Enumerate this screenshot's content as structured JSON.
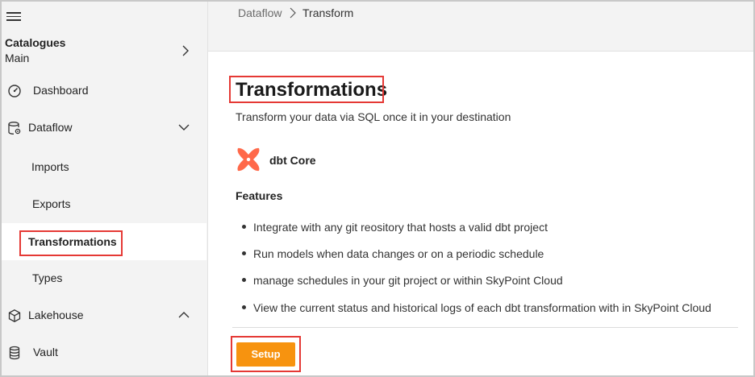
{
  "sidebar": {
    "catalogue_title": "Catalogues",
    "catalogue_subtitle": "Main",
    "items": [
      {
        "label": "Dashboard",
        "icon": "dashboard-gauge-icon"
      },
      {
        "label": "Dataflow",
        "icon": "dataflow-icon"
      },
      {
        "label": "Imports"
      },
      {
        "label": "Exports"
      },
      {
        "label": "Transformations",
        "active": true
      },
      {
        "label": "Types"
      },
      {
        "label": "Lakehouse",
        "icon": "cube-icon"
      },
      {
        "label": "Vault",
        "icon": "database-icon"
      }
    ]
  },
  "breadcrumb": {
    "items": [
      "Dataflow",
      "Transform"
    ]
  },
  "main": {
    "title": "Transformations",
    "subtitle": "Transform your data via SQL once it in your destination",
    "tool_name": "dbt Core",
    "features_heading": "Features",
    "features": [
      "Integrate with any git reository that hosts a valid dbt project",
      "Run models when data changes or on a periodic schedule",
      "manage schedules in your git project or within SkyPoint Cloud",
      "View the current status and historical logs of each dbt transformation with in SkyPoint Cloud"
    ],
    "setup_label": "Setup"
  },
  "colors": {
    "accent": "#f7930f",
    "highlight": "#e53935",
    "dbt_logo": "#ff694a"
  }
}
